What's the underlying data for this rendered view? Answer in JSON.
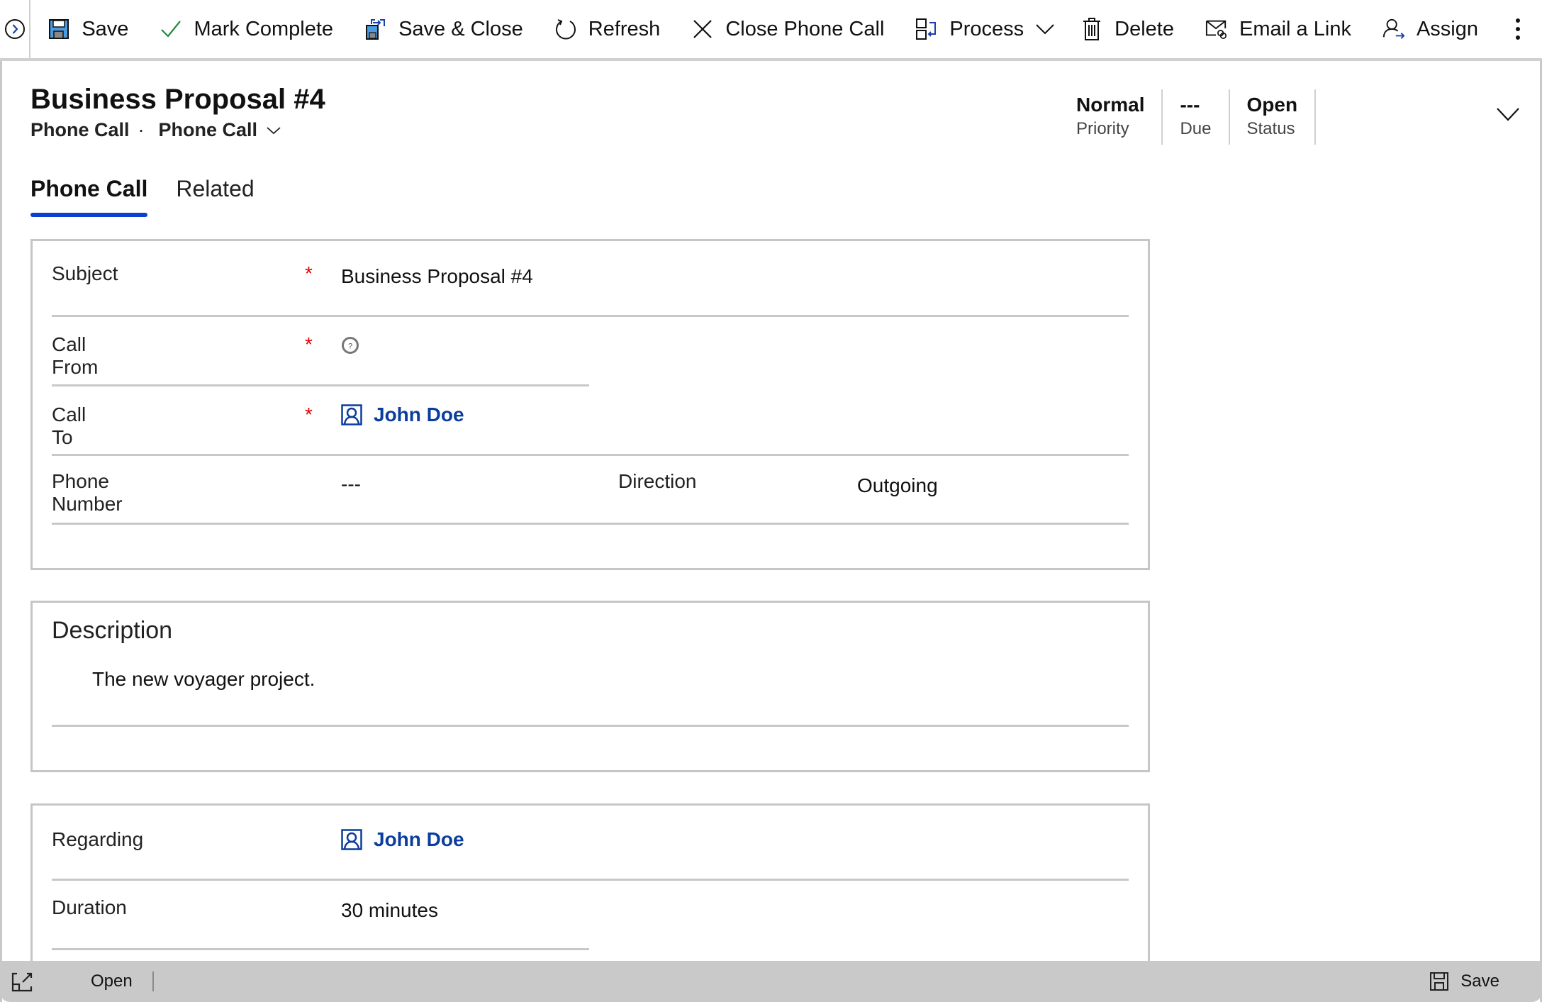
{
  "toolbar": {
    "nav_toggle": "expand-nav",
    "buttons": [
      {
        "label": "Save",
        "icon": "save-icon"
      },
      {
        "label": "Mark Complete",
        "icon": "checkmark-icon"
      },
      {
        "label": "Save & Close",
        "icon": "save-close-icon"
      },
      {
        "label": "Refresh",
        "icon": "refresh-icon"
      },
      {
        "label": "Close Phone Call",
        "icon": "close-icon"
      },
      {
        "label": "Process",
        "icon": "process-icon"
      },
      {
        "label": "Delete",
        "icon": "trash-icon"
      },
      {
        "label": "Email a Link",
        "icon": "email-link-icon"
      },
      {
        "label": "Assign",
        "icon": "assign-icon"
      }
    ],
    "more_icon": "more-vertical-icon"
  },
  "header": {
    "title": "Business Proposal #4",
    "entity": "Phone Call",
    "separator": "·",
    "form_selector": "Phone Call",
    "fields": [
      {
        "value": "Normal",
        "label": "Priority"
      },
      {
        "value": "---",
        "label": "Due"
      },
      {
        "value": "Open",
        "label": "Status"
      }
    ]
  },
  "tabs": [
    {
      "label": "Phone Call",
      "active": true
    },
    {
      "label": "Related",
      "active": false
    }
  ],
  "general": {
    "subject": {
      "label": "Subject",
      "required": "*",
      "value": "Business Proposal #4"
    },
    "call_from": {
      "label": "Call From",
      "required": "*",
      "value": ""
    },
    "call_to": {
      "label": "Call To",
      "required": "*",
      "value": "John Doe"
    },
    "phone_number": {
      "label": "Phone Number",
      "value": "---"
    },
    "direction": {
      "label": "Direction",
      "value": "Outgoing"
    }
  },
  "description": {
    "title": "Description",
    "text": "The new voyager project."
  },
  "details": {
    "regarding": {
      "label": "Regarding",
      "value": "John Doe"
    },
    "duration": {
      "label": "Duration",
      "value": "30 minutes"
    }
  },
  "footer": {
    "open_label": "Open",
    "save_label": "Save"
  },
  "colors": {
    "accent": "#0b3fd1",
    "link": "#0a3d9c",
    "required": "#e00000",
    "footer_bg": "#c9c9c9"
  }
}
